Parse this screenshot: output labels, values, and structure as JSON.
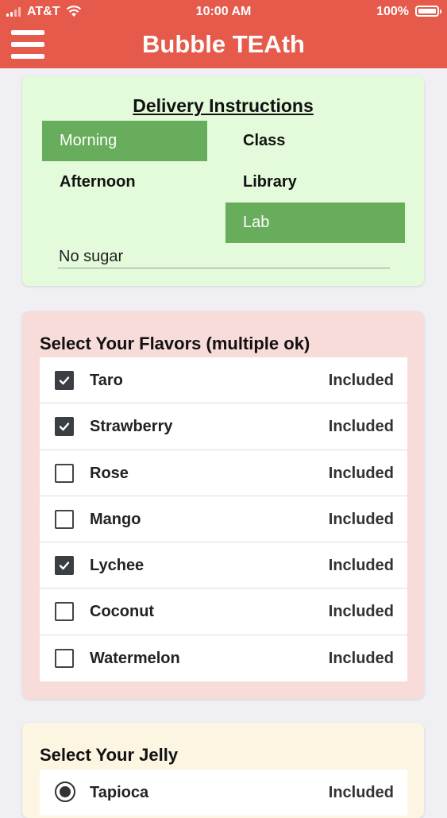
{
  "status_bar": {
    "carrier": "AT&T",
    "time": "10:00 AM",
    "battery": "100%",
    "battery_level": 1.0
  },
  "header": {
    "title": "Bubble TEAth",
    "color": "#E65A4B"
  },
  "delivery": {
    "title": "Delivery Instructions",
    "options": [
      {
        "label": "Morning",
        "selected": true
      },
      {
        "label": "Class",
        "selected": false
      },
      {
        "label": "Afternoon",
        "selected": false
      },
      {
        "label": "Library",
        "selected": false
      },
      {
        "label": "Lab",
        "selected": true
      }
    ],
    "note_value": "No sugar",
    "accent": "#67AD5B"
  },
  "flavors": {
    "title": "Select Your Flavors (multiple ok)",
    "items": [
      {
        "label": "Taro",
        "price": "Included",
        "checked": true
      },
      {
        "label": "Strawberry",
        "price": "Included",
        "checked": true
      },
      {
        "label": "Rose",
        "price": "Included",
        "checked": false
      },
      {
        "label": "Mango",
        "price": "Included",
        "checked": false
      },
      {
        "label": "Lychee",
        "price": "Included",
        "checked": true
      },
      {
        "label": "Coconut",
        "price": "Included",
        "checked": false
      },
      {
        "label": "Watermelon",
        "price": "Included",
        "checked": false
      }
    ]
  },
  "jelly": {
    "title": "Select Your Jelly",
    "items": [
      {
        "label": "Tapioca",
        "price": "Included",
        "checked": true
      }
    ]
  }
}
